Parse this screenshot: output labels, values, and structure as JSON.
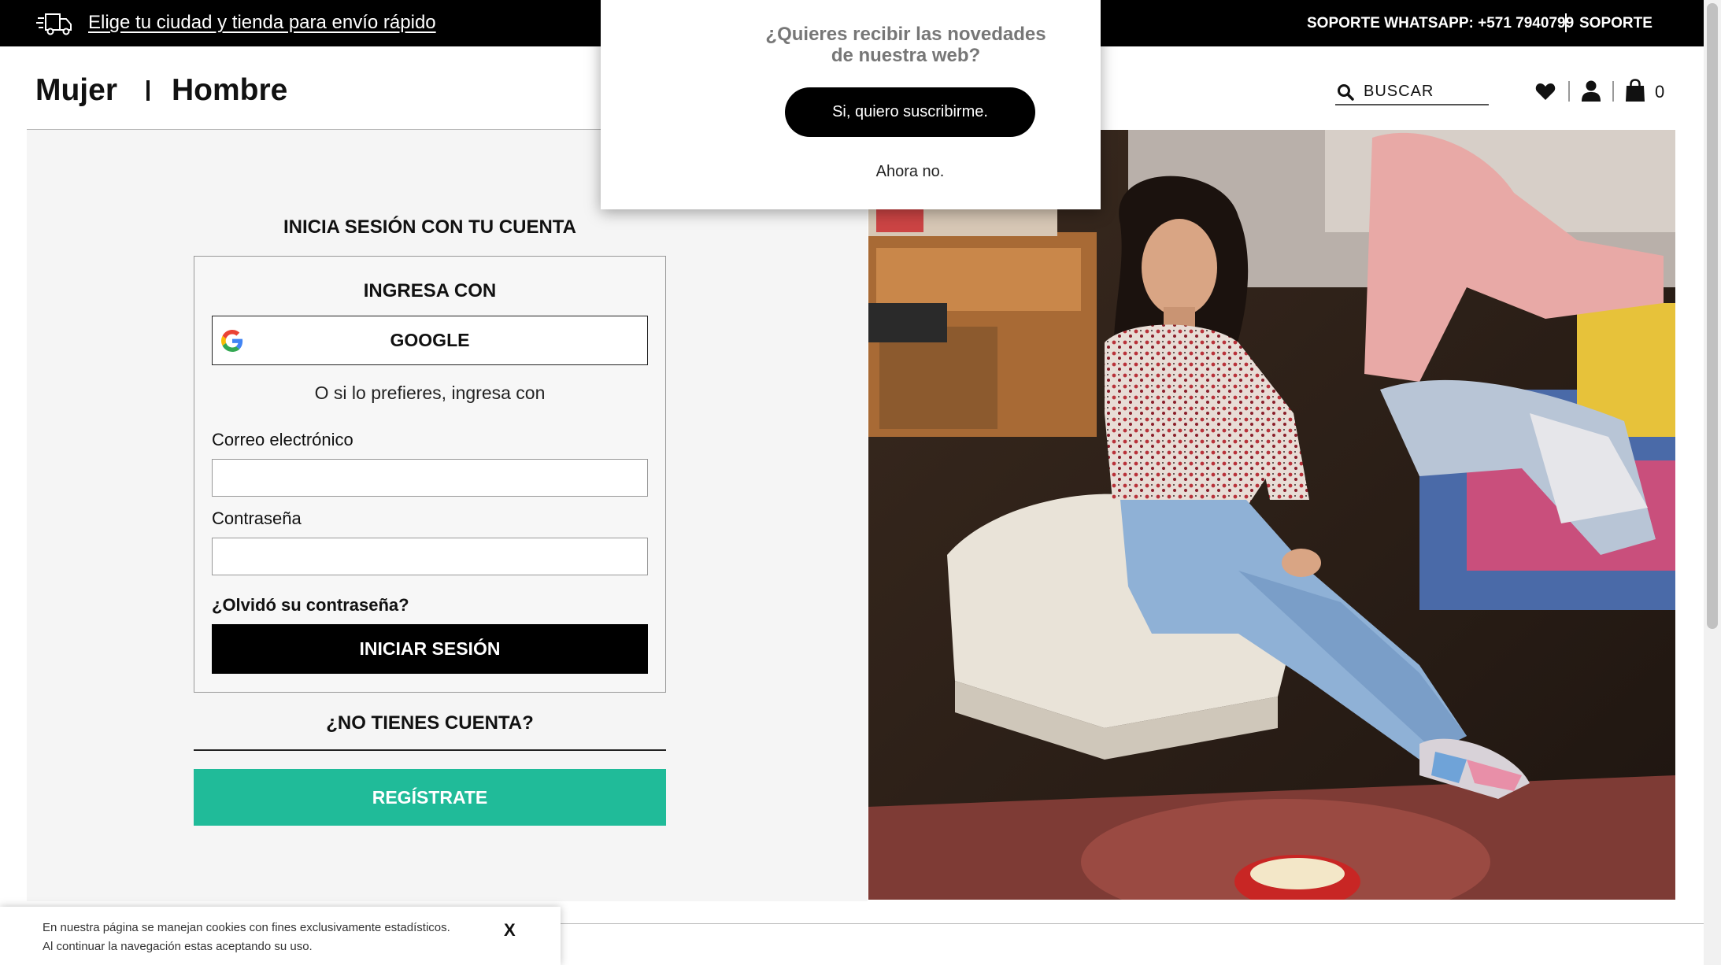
{
  "topbar": {
    "city_link": "Elige tu ciudad y tienda para envío rápido",
    "support_whatsapp": "SOPORTE WHATSAPP: +571 7940799",
    "support": "SOPORTE"
  },
  "nav": {
    "mujer": "Mujer",
    "hombre": "Hombre"
  },
  "search": {
    "placeholder": "BUSCAR"
  },
  "header_icons": {
    "wishlist": "heart-icon",
    "account": "user-icon",
    "cart": "shopping-bag-icon",
    "cart_count": "0"
  },
  "login": {
    "title": "INICIA SESIÓN CON TU CUENTA",
    "ingresa_con": "INGRESA CON",
    "google": "GOOGLE",
    "alt_text": "O si lo prefieres, ingresa con",
    "email_label": "Correo electrónico",
    "email_value": "",
    "password_label": "Contraseña",
    "password_value": "",
    "forgot": "¿Olvidó su contraseña?",
    "submit": "INICIAR SESIÓN",
    "no_account": "¿NO TIENES CUENTA?",
    "register": "REGÍSTRATE"
  },
  "popup": {
    "question": "¿Quieres recibir las novedades de nuestra web?",
    "yes": "Si, quiero suscribirme.",
    "no": "Ahora no."
  },
  "cookie": {
    "text": "En nuestra página se manejan cookies con fines exclusivamente estadísticos. Al continuar la navegación estas aceptando su uso.",
    "close": "X"
  },
  "colors": {
    "topbar": "#000000",
    "register_button": "#20bb99",
    "login_button": "#000000",
    "panel_bg": "#f5f5f5"
  }
}
